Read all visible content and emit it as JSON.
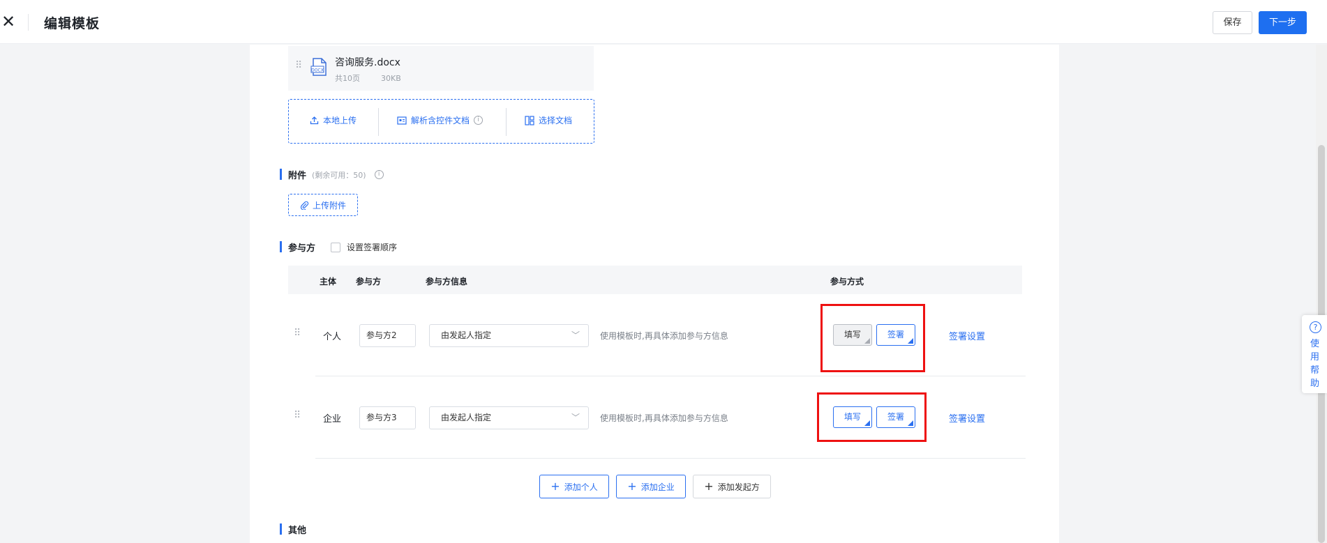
{
  "header": {
    "title": "编辑模板",
    "save_label": "保存",
    "next_label": "下一步"
  },
  "file": {
    "name": "咨询服务.docx",
    "pages": "共10页",
    "size": "30KB",
    "icon": "docx-file-icon"
  },
  "upload": {
    "local": "本地上传",
    "parse": "解析含控件文档",
    "choose": "选择文档"
  },
  "attachments": {
    "title": "附件",
    "note": "(剩余可用：50)",
    "upload_label": "上传附件"
  },
  "participants": {
    "title": "参与方",
    "order_checkbox_label": "设置签署顺序",
    "order_checked": false,
    "columns": {
      "subject": "主体",
      "party": "参与方",
      "info": "参与方信息",
      "mode": "参与方式"
    },
    "rows": [
      {
        "subject": "个人",
        "party_value": "参与方2",
        "select_value": "由发起人指定",
        "hint": "使用模板时,再具体添加参与方信息",
        "fill_label": "填写",
        "fill_active": false,
        "sign_label": "签署",
        "sign_active": true,
        "settings_label": "签署设置"
      },
      {
        "subject": "企业",
        "party_value": "参与方3",
        "select_value": "由发起人指定",
        "hint": "使用模板时,再具体添加参与方信息",
        "fill_label": "填写",
        "fill_active": true,
        "sign_label": "签署",
        "sign_active": true,
        "settings_label": "签署设置"
      }
    ],
    "add_person": "添加个人",
    "add_company": "添加企业",
    "add_initiator": "添加发起方"
  },
  "other": {
    "title": "其他"
  },
  "help": {
    "label": "使用帮助"
  },
  "colors": {
    "accent": "#1e6ff0",
    "highlight": "#ee1111"
  }
}
